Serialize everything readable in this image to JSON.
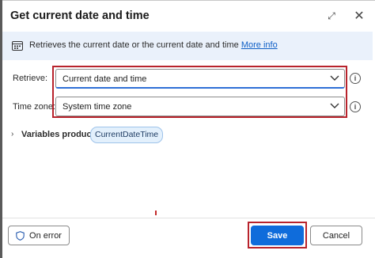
{
  "dialog": {
    "title": "Get current date and time"
  },
  "info": {
    "text": "Retrieves the current date or the current date and time",
    "link": "More info"
  },
  "fields": {
    "retrieve": {
      "label": "Retrieve:",
      "value": "Current date and time"
    },
    "timezone": {
      "label": "Time zone:",
      "value": "System time zone"
    }
  },
  "variables": {
    "label": "Variables produced",
    "items": [
      "CurrentDateTime"
    ]
  },
  "footer": {
    "on_error": "On error",
    "save": "Save",
    "cancel": "Cancel"
  },
  "colors": {
    "accent": "#0f6cdb",
    "highlight": "#b8232c",
    "info_bg": "#eaf1fb"
  }
}
